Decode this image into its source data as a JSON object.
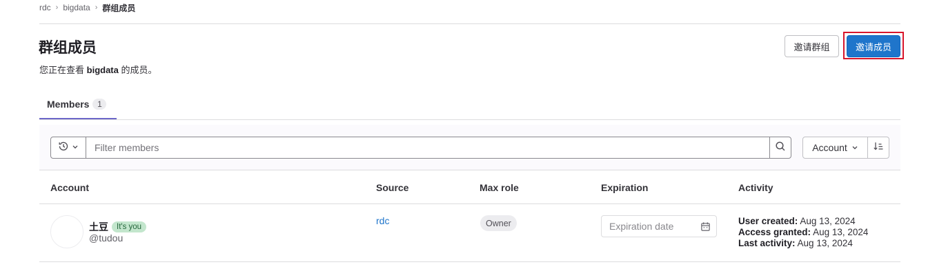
{
  "breadcrumb": {
    "items": [
      "rdc",
      "bigdata",
      "群组成员"
    ]
  },
  "header": {
    "title": "群组成员",
    "desc_prefix": "您正在查看",
    "desc_group": "bigdata",
    "desc_suffix": "的成员。",
    "invite_group_label": "邀请群组",
    "invite_member_label": "邀请成员"
  },
  "tabs": [
    {
      "label": "Members",
      "count": "1"
    }
  ],
  "filter": {
    "placeholder": "Filter members",
    "sort_label": "Account",
    "icons": [
      "history-icon",
      "chevron-down-icon",
      "search-icon",
      "sort-lowest-icon"
    ]
  },
  "table": {
    "columns": [
      "Account",
      "Source",
      "Max role",
      "Expiration",
      "Activity"
    ],
    "rows": [
      {
        "name": "土豆",
        "you_badge": "It's you",
        "username": "@tudou",
        "source": "rdc",
        "role": "Owner",
        "expiration_placeholder": "Expiration date",
        "activity": {
          "created_label": "User created:",
          "created_value": "Aug 13, 2024",
          "granted_label": "Access granted:",
          "granted_value": "Aug 13, 2024",
          "last_label": "Last activity:",
          "last_value": "Aug 13, 2024"
        }
      }
    ]
  },
  "colors": {
    "primary": "#1f75cb",
    "highlight_border": "#d8152b",
    "tab_underline": "#6b66c8",
    "success_badge_bg": "#c3e6cd"
  }
}
